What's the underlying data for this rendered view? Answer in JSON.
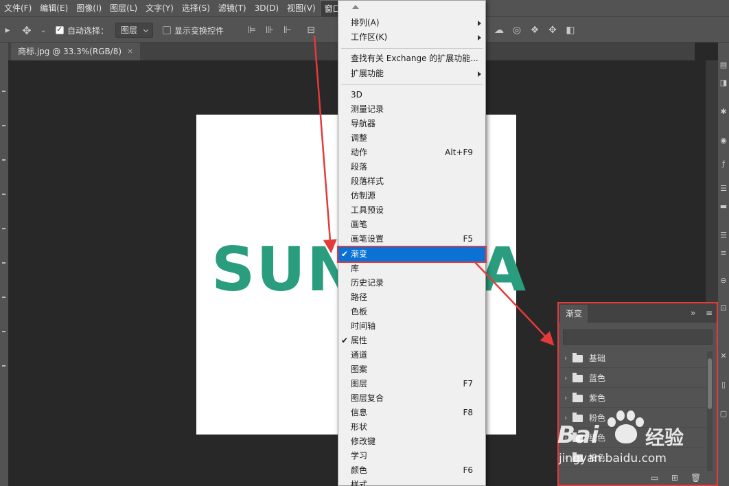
{
  "menubar": {
    "items": [
      "文件(F)",
      "编辑(E)",
      "图像(I)",
      "图层(L)",
      "文字(Y)",
      "选择(S)",
      "滤镜(T)",
      "3D(D)",
      "视图(V)",
      "窗口(W)"
    ]
  },
  "options_bar": {
    "auto_select_label": "自动选择：",
    "auto_select_value": "图层",
    "show_transform_label": "显示变换控件"
  },
  "document": {
    "tab_title": "商标.jpg @ 33.3%(RGB/8)",
    "close_glyph": "×",
    "canvas_text_left": "SUN",
    "canvas_text_right": "A"
  },
  "window_menu": {
    "items": [
      {
        "label": "排列(A)",
        "submenu": true
      },
      {
        "label": "工作区(K)",
        "submenu": true
      },
      {
        "label": "查找有关 Exchange 的扩展功能..."
      },
      {
        "label": "扩展功能",
        "submenu": true
      },
      {
        "label": "3D"
      },
      {
        "label": "测量记录"
      },
      {
        "label": "导航器"
      },
      {
        "label": "调整"
      },
      {
        "label": "动作",
        "shortcut": "Alt+F9"
      },
      {
        "label": "段落"
      },
      {
        "label": "段落样式"
      },
      {
        "label": "仿制源"
      },
      {
        "label": "工具预设"
      },
      {
        "label": "画笔"
      },
      {
        "label": "画笔设置",
        "shortcut": "F5"
      },
      {
        "label": "渐变",
        "checked": true,
        "highlighted": true
      },
      {
        "label": "库"
      },
      {
        "label": "历史记录"
      },
      {
        "label": "路径"
      },
      {
        "label": "色板"
      },
      {
        "label": "时间轴"
      },
      {
        "label": "属性",
        "checked": true
      },
      {
        "label": "通道"
      },
      {
        "label": "图案"
      },
      {
        "label": "图层",
        "shortcut": "F7"
      },
      {
        "label": "图层复合"
      },
      {
        "label": "信息",
        "shortcut": "F8"
      },
      {
        "label": "形状"
      },
      {
        "label": "修改键"
      },
      {
        "label": "学习"
      },
      {
        "label": "颜色",
        "shortcut": "F6"
      },
      {
        "label": "样式"
      }
    ],
    "check_glyph": "✔"
  },
  "gradient_panel": {
    "tab_label": "渐变",
    "collapse_glyph": "»",
    "menu_glyph": "≡",
    "groups": [
      "基础",
      "蓝色",
      "紫色",
      "粉色",
      "红色",
      "橙色"
    ],
    "chevron_glyph": "›",
    "footer_new_group_glyph": "▭",
    "footer_new_glyph": "⊞",
    "footer_delete_glyph": "🗑"
  },
  "watermark": {
    "brand": "Bai",
    "brand_cn": "经验",
    "url": "jingyan.baidu.com"
  },
  "colors": {
    "highlight": "#0a72d4",
    "annotation_red": "#e43a3a",
    "logo_green": "#2a9d7f"
  }
}
